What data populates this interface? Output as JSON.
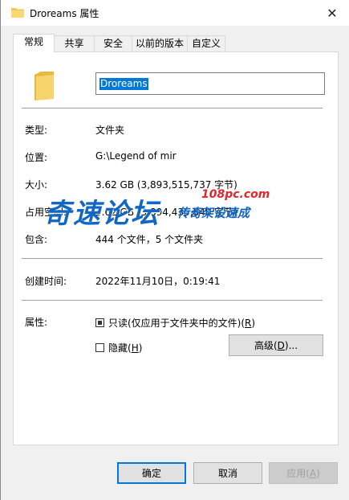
{
  "window": {
    "title": "Droreams 属性",
    "close_glyph": "✕"
  },
  "tabs": [
    {
      "label": "常规",
      "active": true
    },
    {
      "label": "共享"
    },
    {
      "label": "安全"
    },
    {
      "label": "以前的版本"
    },
    {
      "label": "自定义"
    }
  ],
  "general": {
    "name_value": "Droreams",
    "rows": [
      {
        "label": "类型:",
        "value": "文件夹"
      },
      {
        "label": "位置:",
        "value": "G:\\Legend of mir"
      },
      {
        "label": "大小:",
        "value": "3.62 GB (3,893,515,737 字节)"
      },
      {
        "label": "占用空间:",
        "value": "3.62 GB (3,894,435,840 字节)"
      },
      {
        "label": "包含:",
        "value": "444 个文件，5 个文件夹"
      },
      {
        "label": "创建时间:",
        "value": "2022年11月10日，0:19:41"
      }
    ],
    "attributes": {
      "label": "属性:",
      "readonly_text": "只读(仅应用于文件夹中的文件)(",
      "readonly_key": "R",
      "readonly_state": "indeterminate",
      "hidden_text": "隐藏(",
      "hidden_key": "H",
      "hidden_checked": false,
      "advanced_text": "高级(",
      "advanced_key": "D",
      "advanced_suffix": ")..."
    }
  },
  "watermark": {
    "brand": "奇速论坛",
    "url": "108pc.com",
    "slogan": "传奇架设速成"
  },
  "footer": {
    "ok": "确定",
    "cancel": "取消",
    "apply_text": "应用(",
    "apply_key": "A"
  },
  "colors": {
    "accent": "#0078d7",
    "folder_yellow": "#f2c94c",
    "watermark_blue": "#1266c4",
    "watermark_red": "#e1262c"
  }
}
